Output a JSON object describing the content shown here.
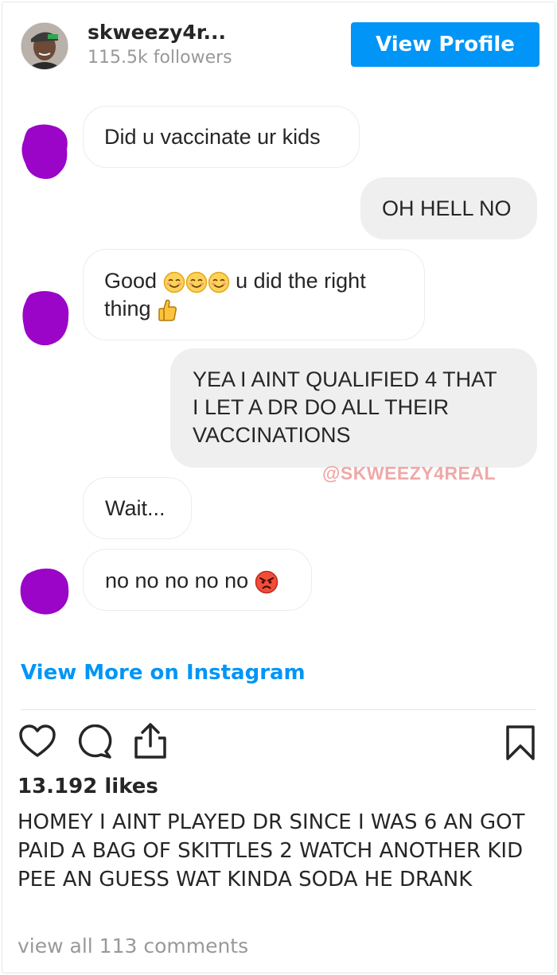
{
  "header": {
    "username": "skweezy4r...",
    "followers": "115.5k followers",
    "view_profile_label": "View Profile"
  },
  "chat": {
    "messages": [
      {
        "side": "incoming",
        "text": "Did u vaccinate ur kids"
      },
      {
        "side": "outgoing",
        "text": "OH HELL NO"
      },
      {
        "side": "incoming",
        "line1": "Good",
        "line1_after": "u did the right",
        "line2": "thing",
        "emojis": [
          "smiling-face-icon",
          "smiling-face-icon",
          "smiling-face-icon",
          "thumbs-up-icon"
        ]
      },
      {
        "side": "outgoing",
        "line1": "YEA I AINT QUALIFIED 4 THAT",
        "line2": "I LET A DR DO ALL THEIR",
        "line3": "VACCINATIONS"
      },
      {
        "side": "incoming",
        "text": "Wait..."
      },
      {
        "side": "incoming",
        "text": "no no no no no",
        "emoji": "angry-face-icon"
      }
    ],
    "watermark": "@SKWEEZY4REAL",
    "redaction_color": "#9b05c8"
  },
  "view_more_label": "View More on Instagram",
  "actions": {
    "icons": [
      "heart-icon",
      "comment-icon",
      "share-icon",
      "bookmark-icon"
    ]
  },
  "likes": "13.192 likes",
  "caption": "HOMEY I AINT PLAYED DR SINCE I WAS 6 AN GOT PAID A BAG OF SKITTLES 2 WATCH ANOTHER KID PEE AN GUESS WAT KINDA SODA HE DRANK",
  "comments_link": "view all 113 comments",
  "colors": {
    "accent": "#0095f6",
    "text": "#262626",
    "muted": "#999999"
  }
}
